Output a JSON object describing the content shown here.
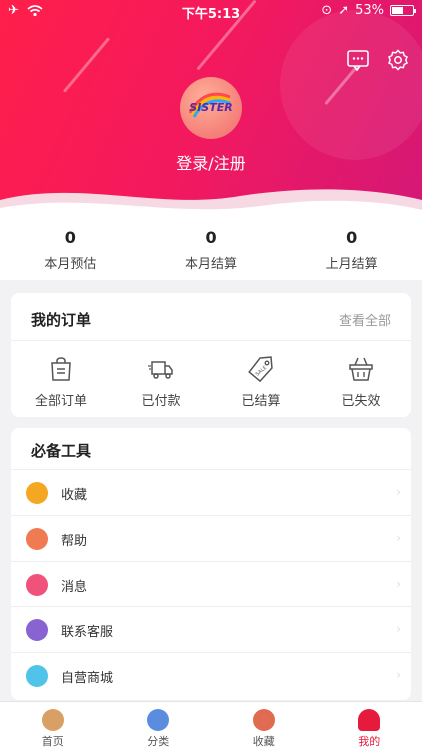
{
  "status_bar": {
    "time": "下午5:13",
    "battery": "53%"
  },
  "header": {
    "avatar_text": "SISTER",
    "login_label": "登录/注册"
  },
  "stats": [
    {
      "value": "0",
      "label": "本月预估"
    },
    {
      "value": "0",
      "label": "本月结算"
    },
    {
      "value": "0",
      "label": "上月结算"
    }
  ],
  "orders": {
    "title": "我的订单",
    "more": "查看全部",
    "items": [
      {
        "label": "全部订单",
        "icon": "shopping-bag-icon"
      },
      {
        "label": "已付款",
        "icon": "delivery-truck-icon"
      },
      {
        "label": "已结算",
        "icon": "price-tag-icon"
      },
      {
        "label": "已失效",
        "icon": "basket-icon"
      }
    ]
  },
  "tools": {
    "title": "必备工具",
    "items": [
      {
        "label": "收藏",
        "icon": "favorites-icon",
        "color": "#f5a623"
      },
      {
        "label": "帮助",
        "icon": "help-icon",
        "color": "#f07b52"
      },
      {
        "label": "消息",
        "icon": "message-icon",
        "color": "#f0527a"
      },
      {
        "label": "联系客服",
        "icon": "customer-service-icon",
        "color": "#8a63d2"
      },
      {
        "label": "自营商城",
        "icon": "store-icon",
        "color": "#4fc3e8"
      }
    ]
  },
  "tabbar": {
    "items": [
      {
        "label": "首页",
        "icon": "home-icon",
        "color": "#d9a066"
      },
      {
        "label": "分类",
        "icon": "category-icon",
        "color": "#5a8de0"
      },
      {
        "label": "收藏",
        "icon": "star-icon",
        "color": "#e06a52"
      },
      {
        "label": "我的",
        "icon": "user-icon",
        "color": "#e51a3d"
      }
    ],
    "active": "我的"
  }
}
